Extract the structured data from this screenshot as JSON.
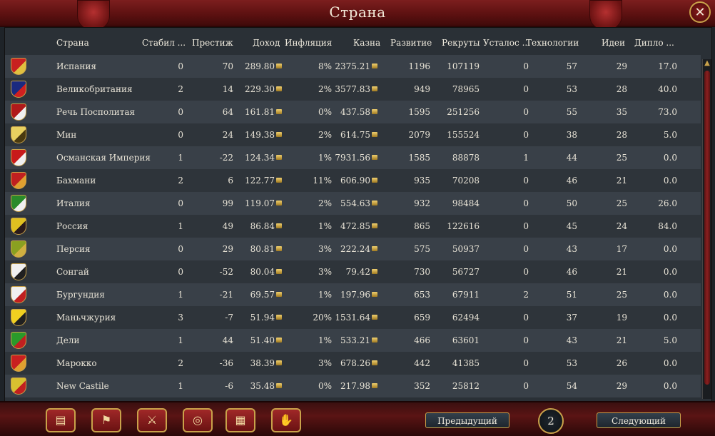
{
  "window": {
    "title": "Страна"
  },
  "header": {
    "country": "Страна",
    "stability": "Стабил ...",
    "prestige": "Престиж",
    "income": "Доход",
    "inflation": "Инфляция",
    "treasury": "Казна",
    "development": "Развитие",
    "manpower": "Рекруты",
    "war_exhaustion": "Усталос ...",
    "technology": "Технологии",
    "ideas": "Идеи",
    "diplo": "Дипло ..."
  },
  "rows": [
    {
      "country": "Испания",
      "stability": "0",
      "prestige": "70",
      "income": "289.80",
      "inflation": "8%",
      "treasury": "2375.21",
      "development": "1196",
      "manpower": "107119",
      "war_exhaustion": "0",
      "technology": "57",
      "ideas": "29",
      "diplo": "17.0",
      "flag_colors": [
        "#c82020",
        "#e0c040"
      ]
    },
    {
      "country": "Великобритания",
      "stability": "2",
      "prestige": "14",
      "income": "229.30",
      "inflation": "2%",
      "treasury": "3577.83",
      "development": "949",
      "manpower": "78965",
      "war_exhaustion": "0",
      "technology": "53",
      "ideas": "28",
      "diplo": "40.0",
      "flag_colors": [
        "#1a2a80",
        "#d02020"
      ]
    },
    {
      "country": "Речь Посполитая",
      "stability": "0",
      "prestige": "64",
      "income": "161.81",
      "inflation": "0%",
      "treasury": "437.58",
      "development": "1595",
      "manpower": "251256",
      "war_exhaustion": "0",
      "technology": "55",
      "ideas": "35",
      "diplo": "73.0",
      "flag_colors": [
        "#b01a1a",
        "#f0f0f0"
      ]
    },
    {
      "country": "Мин",
      "stability": "0",
      "prestige": "24",
      "income": "149.38",
      "inflation": "2%",
      "treasury": "614.75",
      "development": "2079",
      "manpower": "155524",
      "war_exhaustion": "0",
      "technology": "38",
      "ideas": "28",
      "diplo": "5.0",
      "flag_colors": [
        "#e8d060",
        "#4a3a10"
      ]
    },
    {
      "country": "Османская Империя",
      "stability": "1",
      "prestige": "-22",
      "income": "124.34",
      "inflation": "1%",
      "treasury": "7931.56",
      "development": "1585",
      "manpower": "88878",
      "war_exhaustion": "1",
      "technology": "44",
      "ideas": "25",
      "diplo": "0.0",
      "flag_colors": [
        "#c81a1a",
        "#f0f0f0"
      ]
    },
    {
      "country": "Бахмани",
      "stability": "2",
      "prestige": "6",
      "income": "122.77",
      "inflation": "11%",
      "treasury": "606.90",
      "development": "935",
      "manpower": "70208",
      "war_exhaustion": "0",
      "technology": "46",
      "ideas": "21",
      "diplo": "0.0",
      "flag_colors": [
        "#c02020",
        "#e0a030"
      ]
    },
    {
      "country": "Италия",
      "stability": "0",
      "prestige": "99",
      "income": "119.07",
      "inflation": "2%",
      "treasury": "554.63",
      "development": "932",
      "manpower": "98484",
      "war_exhaustion": "0",
      "technology": "50",
      "ideas": "25",
      "diplo": "26.0",
      "flag_colors": [
        "#2a8a2a",
        "#f0f0f0"
      ]
    },
    {
      "country": "Россия",
      "stability": "1",
      "prestige": "49",
      "income": "86.84",
      "inflation": "1%",
      "treasury": "472.85",
      "development": "865",
      "manpower": "122616",
      "war_exhaustion": "0",
      "technology": "45",
      "ideas": "24",
      "diplo": "84.0",
      "flag_colors": [
        "#e0c020",
        "#2a1a1a"
      ]
    },
    {
      "country": "Персия",
      "stability": "0",
      "prestige": "29",
      "income": "80.81",
      "inflation": "3%",
      "treasury": "222.24",
      "development": "575",
      "manpower": "50937",
      "war_exhaustion": "0",
      "technology": "43",
      "ideas": "17",
      "diplo": "0.0",
      "flag_colors": [
        "#8aa020",
        "#d0b040"
      ]
    },
    {
      "country": "Сонгай",
      "stability": "0",
      "prestige": "-52",
      "income": "80.04",
      "inflation": "3%",
      "treasury": "79.42",
      "development": "730",
      "manpower": "56727",
      "war_exhaustion": "0",
      "technology": "46",
      "ideas": "21",
      "diplo": "0.0",
      "flag_colors": [
        "#f0f0f0",
        "#202020"
      ]
    },
    {
      "country": "Бургундия",
      "stability": "1",
      "prestige": "-21",
      "income": "69.57",
      "inflation": "1%",
      "treasury": "197.96",
      "development": "653",
      "manpower": "67911",
      "war_exhaustion": "2",
      "technology": "51",
      "ideas": "25",
      "diplo": "0.0",
      "flag_colors": [
        "#f0f0f0",
        "#c02020"
      ]
    },
    {
      "country": "Маньчжурия",
      "stability": "3",
      "prestige": "-7",
      "income": "51.94",
      "inflation": "20%",
      "treasury": "1531.64",
      "development": "659",
      "manpower": "62494",
      "war_exhaustion": "0",
      "technology": "37",
      "ideas": "19",
      "diplo": "0.0",
      "flag_colors": [
        "#f0d020",
        "#202020"
      ]
    },
    {
      "country": "Дели",
      "stability": "1",
      "prestige": "44",
      "income": "51.40",
      "inflation": "1%",
      "treasury": "533.21",
      "development": "466",
      "manpower": "63601",
      "war_exhaustion": "0",
      "technology": "43",
      "ideas": "21",
      "diplo": "5.0",
      "flag_colors": [
        "#2a9a2a",
        "#c02020"
      ]
    },
    {
      "country": "Марокко",
      "stability": "2",
      "prestige": "-36",
      "income": "38.39",
      "inflation": "3%",
      "treasury": "678.26",
      "development": "442",
      "manpower": "41385",
      "war_exhaustion": "0",
      "technology": "53",
      "ideas": "26",
      "diplo": "0.0",
      "flag_colors": [
        "#c82020",
        "#e0a030"
      ]
    },
    {
      "country": "New Castile",
      "stability": "1",
      "prestige": "-6",
      "income": "35.48",
      "inflation": "0%",
      "treasury": "217.98",
      "development": "352",
      "manpower": "25812",
      "war_exhaustion": "0",
      "technology": "54",
      "ideas": "29",
      "diplo": "0.0",
      "flag_colors": [
        "#d8c030",
        "#c02020"
      ]
    }
  ],
  "bottom": {
    "prev_label": "Предыдущий",
    "next_label": "Следующий",
    "page": "2"
  },
  "toolbar_icons": [
    "ledger-icon",
    "flag-icon",
    "crossed-swords-icon",
    "coins-icon",
    "buildings-icon",
    "handshake-icon"
  ]
}
